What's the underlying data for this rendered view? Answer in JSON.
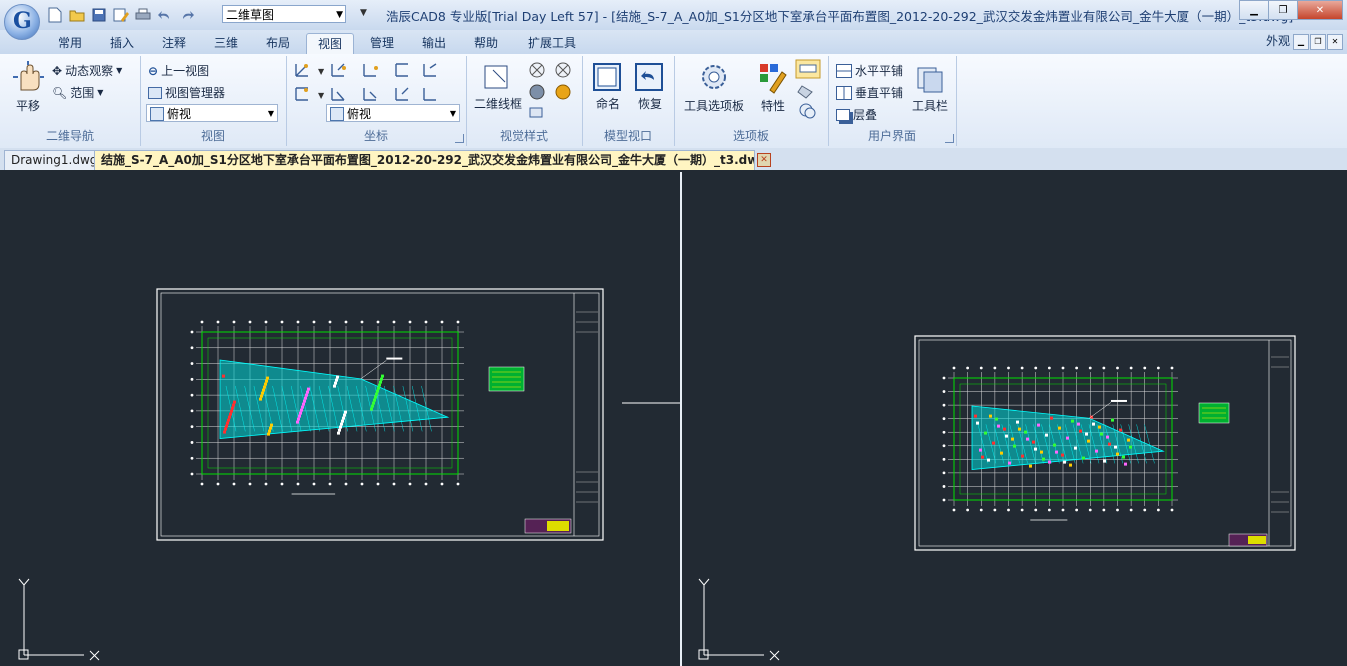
{
  "app": {
    "title": "浩辰CAD8 专业版[Trial Day Left 57] - [结施_S-7_A_A0加_S1分区地下室承台平面布置图_2012-20-292_武汉交发金炜置业有限公司_金牛大厦（一期）_t3.dwg]",
    "logo_letter": "G",
    "workspace": "二维草图"
  },
  "qat": [
    "new-file-icon",
    "open-icon",
    "save-icon",
    "save-as-icon",
    "print-icon",
    "undo-icon",
    "redo-icon"
  ],
  "menu_tabs": [
    "常用",
    "插入",
    "注释",
    "三维",
    "布局",
    "视图",
    "管理",
    "输出",
    "帮助",
    "扩展工具"
  ],
  "active_tab": "视图",
  "appearance_label": "外观",
  "ribbon": {
    "nav": {
      "pan": "平移",
      "orbit": "动态观察",
      "extents": "范围",
      "group": "二维导航"
    },
    "view": {
      "prev": "上一视图",
      "manager": "视图管理器",
      "combo": "俯视",
      "group": "视图"
    },
    "coords": {
      "combo": "俯视",
      "group": "坐标"
    },
    "visual": {
      "wireframe": "二维线框",
      "group": "视觉样式"
    },
    "model_vp": {
      "name": "命名",
      "restore": "恢复",
      "group": "模型视口"
    },
    "palettes": {
      "tool_palettes": "工具选项板",
      "properties": "特性",
      "group": "选项板"
    },
    "ui": {
      "tile_h": "水平平铺",
      "tile_v": "垂直平铺",
      "cascade": "层叠",
      "toolbars": "工具栏",
      "group": "用户界面"
    }
  },
  "doc_tabs": [
    {
      "label": "Drawing1.dwg",
      "active": false
    },
    {
      "label": "结施_S-7_A_A0加_S1分区地下室承台平面布置图_2012-20-292_武汉交发金炜置业有限公司_金牛大厦（一期）_t3.dwg",
      "active": true
    }
  ],
  "viewports": [
    {
      "ucs_y": "Y",
      "ucs_x": "X"
    },
    {
      "ucs_y": "Y",
      "ucs_x": "X"
    }
  ],
  "colors": {
    "canvas": "#222a33",
    "frame": "#ffffff",
    "grid": "#00e000",
    "hatch": "#00d8d8",
    "accent": "#ffee00"
  }
}
